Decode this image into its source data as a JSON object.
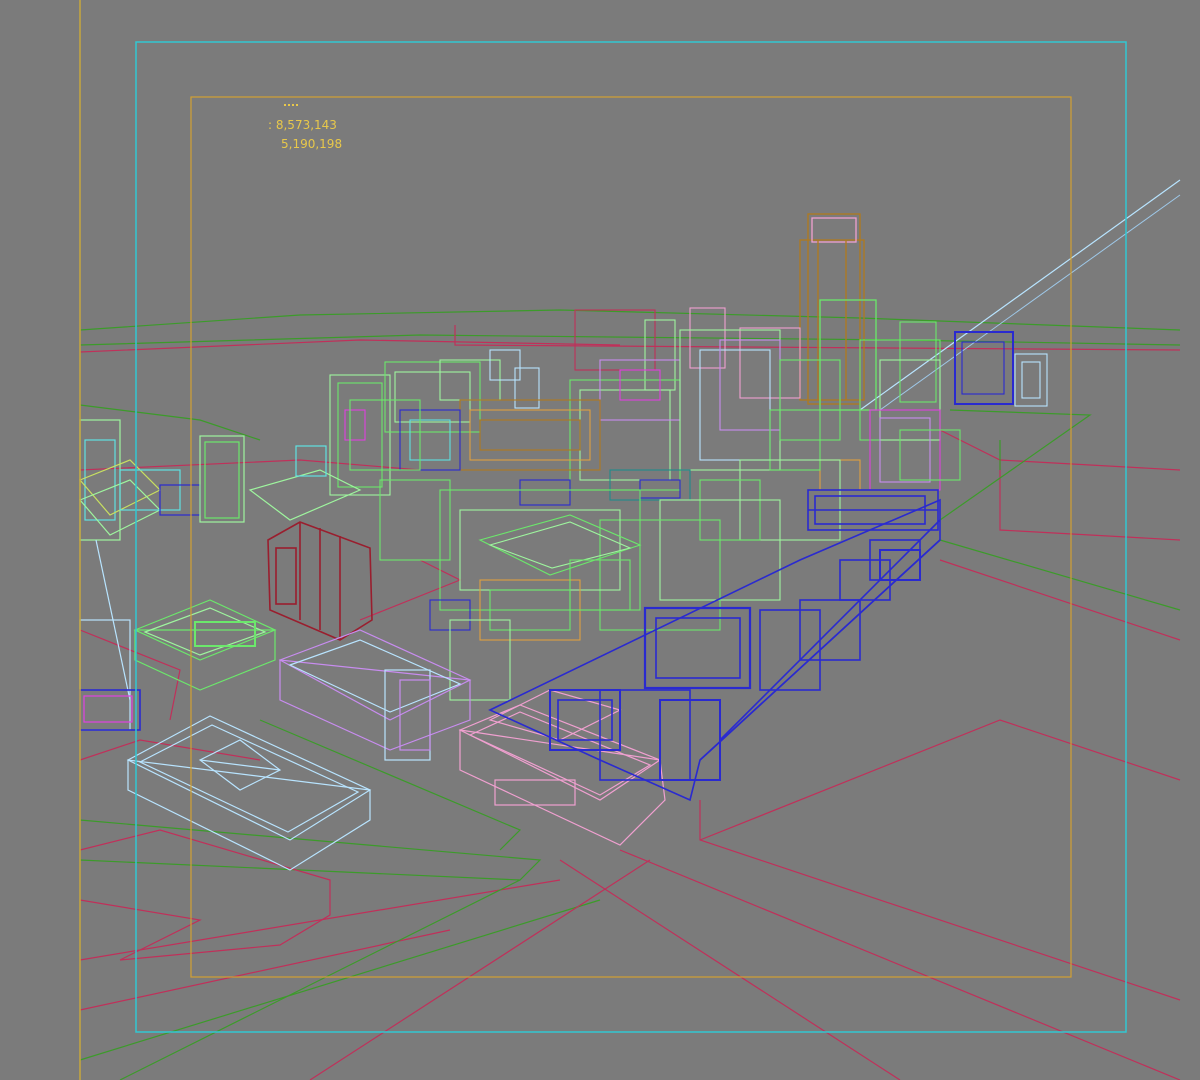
{
  "viewport": {
    "background_color": "#7b7b7b",
    "statistics": {
      "polys": ": 8,573,143",
      "verts": "5,190,198"
    },
    "frame_colors": {
      "outer_safe_frame": "#32c8d2",
      "inner_safe_frame": "#d2a032",
      "left_edge_line": "#c8a83c"
    },
    "wireframe_colors": {
      "green": "#6be86b",
      "light_green": "#9ef59e",
      "dark_green": "#3c9b2a",
      "crimson": "#c0305a",
      "dark_red": "#9a1e2e",
      "blue": "#2a2ad0",
      "pink": "#f0a0d0",
      "light_blue": "#b8e4ff",
      "cyan": "#5ee2e2",
      "violet": "#c88cf0",
      "magenta": "#e040e0",
      "brown": "#b07a1e",
      "orange": "#e0a040",
      "yellow_green": "#c8e060",
      "teal": "#1e8c8c"
    }
  }
}
